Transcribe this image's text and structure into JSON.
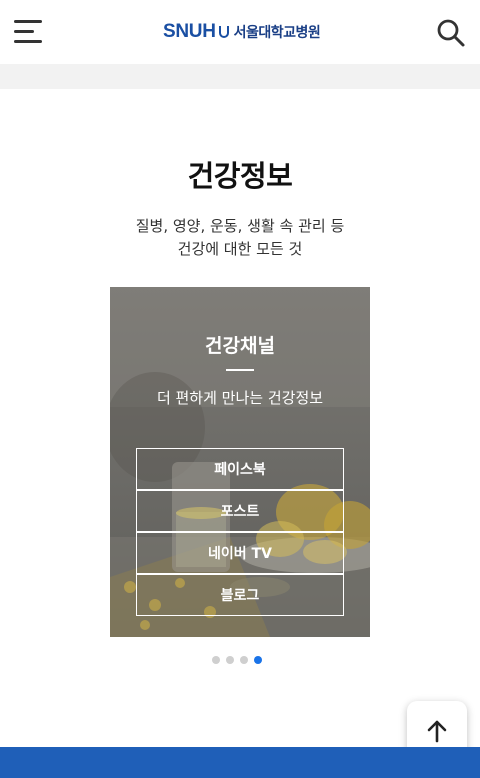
{
  "header": {
    "logo_mark": "SNUH",
    "logo_name": "서울대학교병원",
    "menu_icon": "hamburger-menu-icon",
    "search_icon": "search-icon"
  },
  "section": {
    "title": "건강정보",
    "desc_line1": "질병, 영양, 운동, 생활 속 관리 등",
    "desc_line2": "건강에 대한 모든 것"
  },
  "card": {
    "title": "건강채널",
    "subtitle": "더 편하게 만나는 건강정보",
    "links": [
      "페이스북",
      "포스트",
      "네이버 TV",
      "블로그"
    ]
  },
  "carousel": {
    "total": 4,
    "active_index": 4
  },
  "colors": {
    "brand": "#1a4fa3",
    "active_dot": "#1a73e8",
    "footer_bar": "#1f5fb8"
  },
  "scroll_top_icon": "arrow-up-icon"
}
